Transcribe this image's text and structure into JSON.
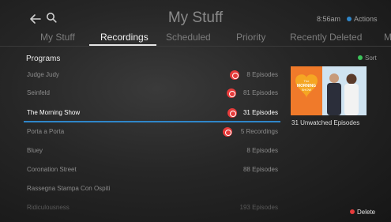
{
  "header": {
    "title": "My Stuff",
    "clock": "8:56am",
    "actions_label": "Actions"
  },
  "tabs": [
    {
      "label": "My Stuff",
      "active": false
    },
    {
      "label": "Recordings",
      "active": true
    },
    {
      "label": "Scheduled",
      "active": false
    },
    {
      "label": "Priority",
      "active": false
    },
    {
      "label": "Recently Deleted",
      "active": false
    },
    {
      "label": "My S",
      "active": false
    }
  ],
  "list": {
    "section_title": "Programs",
    "items": [
      {
        "name": "Judge Judy",
        "count": "8 Episodes",
        "recording": true
      },
      {
        "name": "Seinfeld",
        "count": "81 Episodes",
        "recording": true
      },
      {
        "name": "The Morning Show",
        "count": "31 Episodes",
        "recording": true,
        "selected": true
      },
      {
        "name": "Porta a Porta",
        "count": "5 Recordings",
        "recording": true
      },
      {
        "name": "Bluey",
        "count": "8 Episodes",
        "recording": false
      },
      {
        "name": "Coronation Street",
        "count": "88 Episodes",
        "recording": false
      },
      {
        "name": "Rassegna Stampa Con Ospiti",
        "count": "",
        "recording": false
      },
      {
        "name": "Ridiculousness",
        "count": "193 Episodes",
        "recording": false
      }
    ]
  },
  "detail": {
    "sort_label": "Sort",
    "unwatched": "31 Unwatched Episodes",
    "delete_label": "Delete",
    "thumbnail_logo_text": "The MORNING SHOW"
  },
  "colors": {
    "accent_blue": "#2f86c9",
    "record_red": "#e63b3b",
    "sort_green": "#3cc35a",
    "actions_blue": "#2f86c9"
  }
}
